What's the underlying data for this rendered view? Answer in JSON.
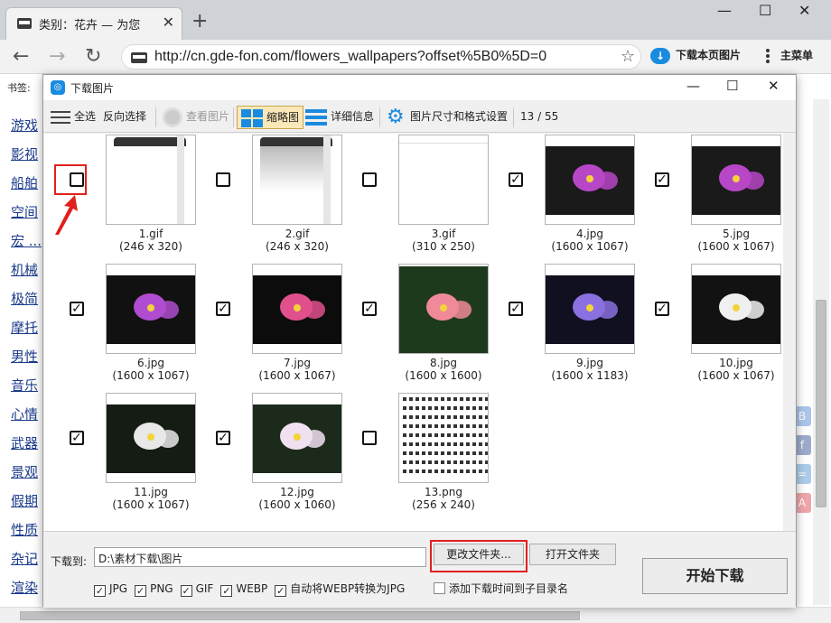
{
  "browser": {
    "tab_title": "类别：花卉 — 为您",
    "tab_close": "✕",
    "new_tab": "+",
    "win_min": "—",
    "win_max": "☐",
    "win_close": "✕",
    "back": "←",
    "forward": "→",
    "reload": "↻",
    "url": "http://cn.gde-fon.com/flowers_wallpapers?offset%5B0%5D=0",
    "star": "☆",
    "download_page_images": "下载本页图片",
    "main_menu": "主菜单",
    "bookmarks_label": "书签:"
  },
  "page": {
    "links": [
      "游戏",
      "影视",
      "船舶",
      "空间",
      "宏 ...",
      "机械",
      "极简",
      "摩托",
      "男性",
      "音乐",
      "心情",
      "武器",
      "景观",
      "假期",
      "性质",
      "杂记",
      "渲染"
    ]
  },
  "dialog": {
    "title": "下载图片",
    "minimize": "—",
    "maximize": "☐",
    "close": "✕",
    "toolbar": {
      "select_all": "全选",
      "invert_selection": "反向选择",
      "view_image": "查看图片",
      "thumbnails": "缩略图",
      "details": "详细信息",
      "size_format_settings": "图片尺寸和格式设置",
      "count": "13 / 55"
    },
    "images": [
      {
        "name": "1.gif",
        "dims": "(246 x 320)",
        "checked": false
      },
      {
        "name": "2.gif",
        "dims": "(246 x 320)",
        "checked": false
      },
      {
        "name": "3.gif",
        "dims": "(310 x 250)",
        "checked": false
      },
      {
        "name": "4.jpg",
        "dims": "(1600 x 1067)",
        "checked": true
      },
      {
        "name": "5.jpg",
        "dims": "(1600 x 1067)",
        "checked": true
      },
      {
        "name": "6.jpg",
        "dims": "(1600 x 1067)",
        "checked": true
      },
      {
        "name": "7.jpg",
        "dims": "(1600 x 1067)",
        "checked": true
      },
      {
        "name": "8.jpg",
        "dims": "(1600 x 1600)",
        "checked": true
      },
      {
        "name": "9.jpg",
        "dims": "(1600 x 1183)",
        "checked": true
      },
      {
        "name": "10.jpg",
        "dims": "(1600 x 1067)",
        "checked": true
      },
      {
        "name": "11.jpg",
        "dims": "(1600 x 1067)",
        "checked": true
      },
      {
        "name": "12.jpg",
        "dims": "(1600 x 1060)",
        "checked": true
      },
      {
        "name": "13.png",
        "dims": "(256 x 240)",
        "checked": false
      }
    ],
    "check_mark": "✓",
    "download_to_label": "下载到:",
    "download_path": "D:\\素材下载\\图片",
    "change_folder": "更改文件夹...",
    "open_folder": "打开文件夹",
    "options": [
      {
        "label": "JPG",
        "checked": true
      },
      {
        "label": "PNG",
        "checked": true
      },
      {
        "label": "GIF",
        "checked": true
      },
      {
        "label": "WEBP",
        "checked": true
      },
      {
        "label": "自动将WEBP转换为JPG",
        "checked": true
      }
    ],
    "add_time_subfolder": "添加下载时间到子目录名",
    "start_download": "开始下载"
  },
  "colors": {
    "accent": "#1a8be0",
    "highlight": "#e0201e",
    "active_tab_bg": "#fbe8b8"
  }
}
